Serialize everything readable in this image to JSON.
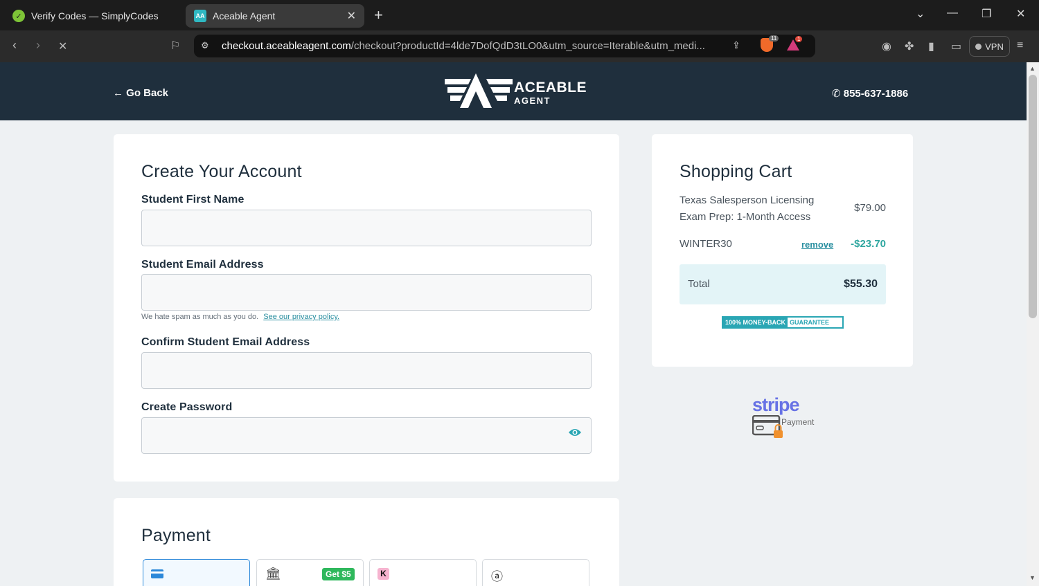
{
  "browser": {
    "tabs": [
      {
        "title": "Verify Codes — SimplyCodes",
        "active": false,
        "favicon": "simplycodes-icon"
      },
      {
        "title": "Aceable Agent",
        "active": true,
        "favicon": "aceable-icon"
      }
    ],
    "url_host": "checkout.aceableagent.com",
    "url_path": "/checkout?productId=4lde7DofQdD3tLO0&utm_source=Iterable&utm_medi...",
    "brave_badge": "11",
    "rewards_badge": "1",
    "vpn_label": "VPN"
  },
  "header": {
    "back_label": "Go Back",
    "logo_line1": "ACEABLE",
    "logo_line2": "AGENT",
    "phone": "855-637-1886"
  },
  "account": {
    "title": "Create Your Account",
    "first_name_label": "Student First Name",
    "email_label": "Student Email Address",
    "hint_text": "We hate spam as much as you do.",
    "privacy_link": "See our privacy policy.",
    "confirm_email_label": "Confirm Student Email Address",
    "password_label": "Create Password"
  },
  "payment": {
    "title": "Payment",
    "tabs": [
      {
        "icon": "card-icon",
        "selected": true
      },
      {
        "icon": "bank-icon",
        "badge": "Get $5"
      },
      {
        "icon": "klarna-icon"
      },
      {
        "icon": "affirm-icon"
      }
    ]
  },
  "cart": {
    "title": "Shopping Cart",
    "item_name": "Texas Salesperson Licensing Exam Prep: 1-Month Access",
    "item_price": "$79.00",
    "coupon_code": "WINTER30",
    "remove_label": "remove",
    "discount": "-$23.70",
    "total_label": "Total",
    "total_value": "$55.30",
    "guarantee_left": "100% MONEY-BACK",
    "guarantee_right": "GUARANTEE"
  },
  "stripe": {
    "word": "stripe",
    "sub": "Payment"
  },
  "colors": {
    "header_bg": "#1f2f3d",
    "accent_teal": "#2aa6b4",
    "stripe_purple": "#6772e5"
  }
}
